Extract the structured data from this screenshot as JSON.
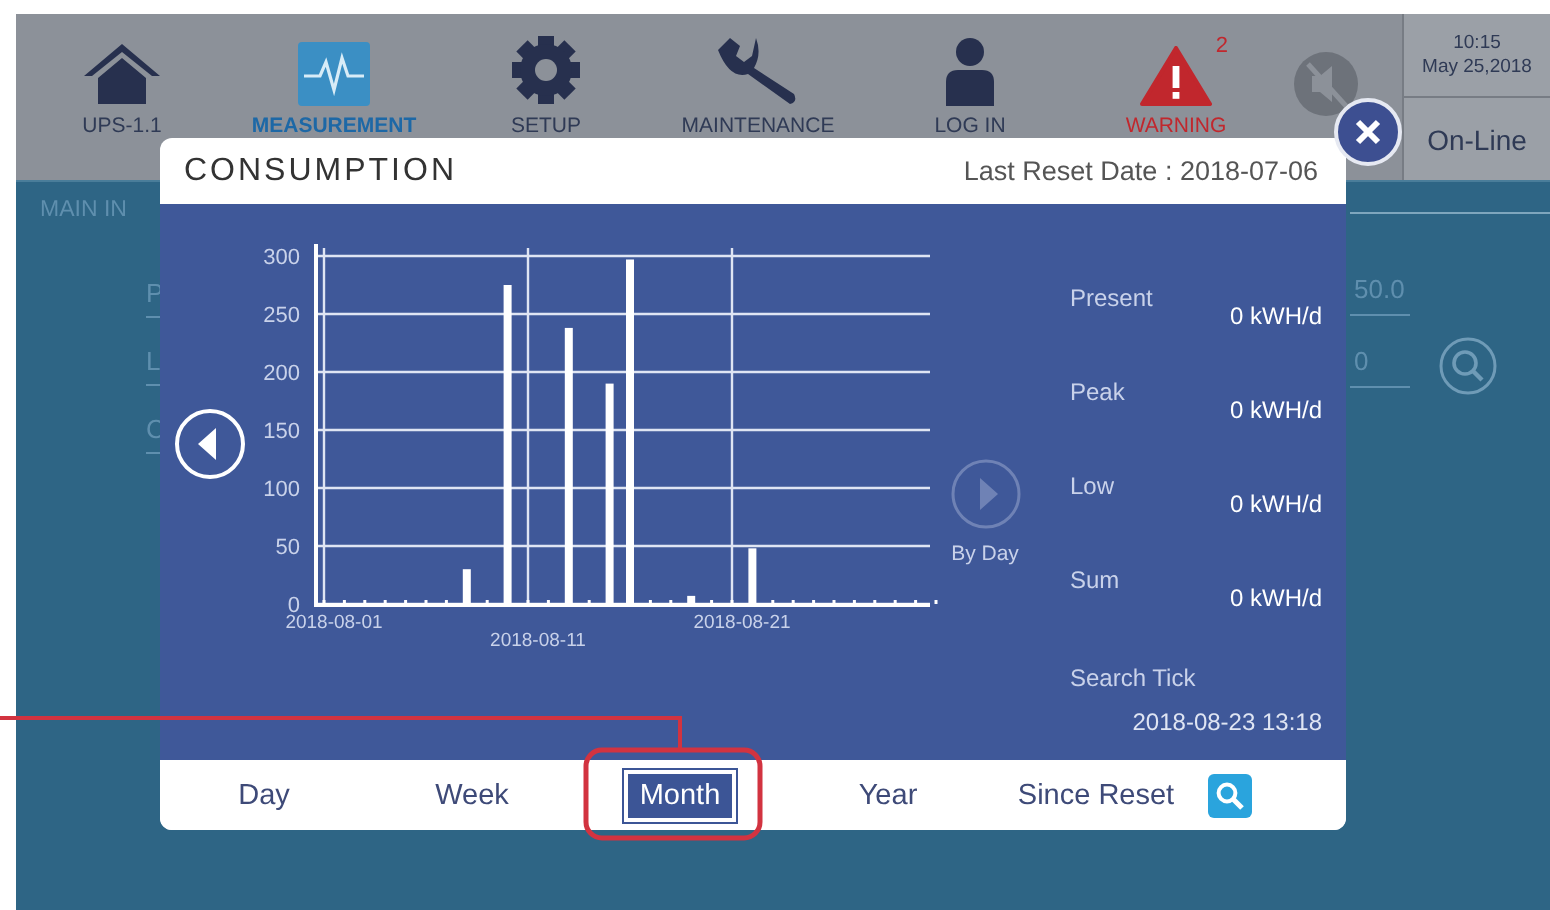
{
  "top_bar": {
    "items": [
      {
        "kind": "home",
        "label": "UPS-1.1",
        "selected": false
      },
      {
        "kind": "measurement",
        "label": "MEASUREMENT",
        "selected": true
      },
      {
        "kind": "setup",
        "label": "SETUP",
        "selected": false
      },
      {
        "kind": "maintenance",
        "label": "MAINTENANCE",
        "selected": false
      },
      {
        "kind": "login",
        "label": "LOG IN",
        "selected": false
      },
      {
        "kind": "warning",
        "label": "WARNING",
        "badge": "2",
        "selected": false
      },
      {
        "kind": "mute",
        "selected": false
      }
    ],
    "clock": {
      "time": "10:15",
      "date": "May 25,2018"
    },
    "status": "On-Line"
  },
  "background": {
    "section_title": "MAIN IN",
    "row_labels": [
      "P",
      "L",
      "C"
    ],
    "values": [
      "50.0",
      "0"
    ]
  },
  "dialog": {
    "title": "CONSUMPTION",
    "last_reset": "Last Reset Date : 2018-07-06",
    "chart_data": {
      "type": "bar",
      "values": [
        0,
        0,
        0,
        0,
        0,
        0,
        0,
        30,
        0,
        275,
        0,
        0,
        238,
        0,
        190,
        297,
        0,
        0,
        7,
        0,
        0,
        48,
        0,
        0,
        0,
        0,
        0,
        0,
        0,
        0,
        0
      ],
      "grid": true,
      "ylim": [
        0,
        300
      ],
      "yticks": [
        0,
        50,
        100,
        150,
        200,
        250,
        300
      ],
      "categories": [
        "2018-08-01",
        null,
        null,
        null,
        null,
        null,
        null,
        null,
        null,
        null,
        "2018-08-11",
        null,
        null,
        null,
        null,
        null,
        null,
        null,
        null,
        null,
        "2018-08-21",
        null,
        null,
        null,
        null,
        null,
        null,
        null,
        null,
        null,
        null
      ]
    },
    "next_button": {
      "label": "By Day",
      "disabled": true
    },
    "stats": [
      {
        "label": "Present",
        "value": "0",
        "unit": "kWH/d"
      },
      {
        "label": "Peak",
        "value": "0",
        "unit": "kWH/d"
      },
      {
        "label": "Low",
        "value": "0",
        "unit": "kWH/d"
      },
      {
        "label": "Sum",
        "value": "0",
        "unit": "kWH/d"
      }
    ],
    "search_tick": {
      "label": "Search Tick",
      "value": "2018-08-23 13:18"
    },
    "tabs": [
      {
        "label": "Day",
        "selected": false
      },
      {
        "label": "Week",
        "selected": false
      },
      {
        "label": "Month",
        "selected": true
      },
      {
        "label": "Year",
        "selected": false
      },
      {
        "label": "Since Reset",
        "selected": false
      }
    ]
  }
}
